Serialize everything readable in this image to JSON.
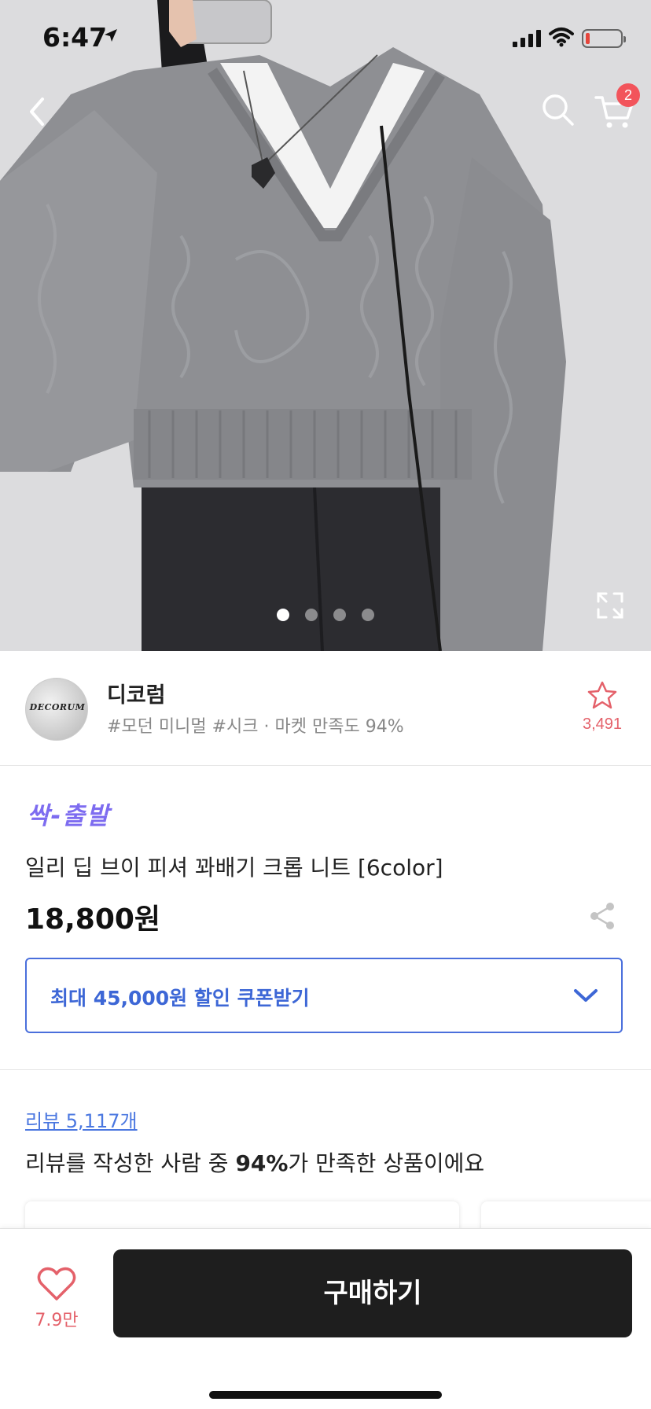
{
  "status_bar": {
    "time": "6:47"
  },
  "header": {
    "cart_count": "2"
  },
  "gallery": {
    "slide_count": 4,
    "active_slide": 1
  },
  "shop": {
    "name": "디코럼",
    "logo_text": "DECORUM",
    "tags": "#모던 미니멀 #시크 · 마켓 만족도 94%",
    "favorite_count": "3,491"
  },
  "product": {
    "delivery_badge": "싹-출발",
    "name": "일리 딥 브이 피셔 꽈배기 크롭 니트 [6color]",
    "price": "18,800원"
  },
  "coupon": {
    "label": "최대 45,000원 할인 쿠폰받기"
  },
  "review": {
    "link": "리뷰 5,117개",
    "summary_before": "리뷰를 작성한 사람 중 ",
    "summary_percent": "94%",
    "summary_after": "가 만족한 상품이에요"
  },
  "bottom_bar": {
    "like_count": "7.9만",
    "buy_label": "구매하기"
  },
  "colors": {
    "accent_blue": "#4a6fdc",
    "badge_red": "#f2545b",
    "fast_purple": "#7d6cf0",
    "buy_black": "#1e1e1e"
  },
  "icons": [
    "back-arrow-icon",
    "search-icon",
    "cart-icon",
    "expand-icon",
    "star-icon",
    "share-icon",
    "chevron-down-icon",
    "heart-icon"
  ]
}
